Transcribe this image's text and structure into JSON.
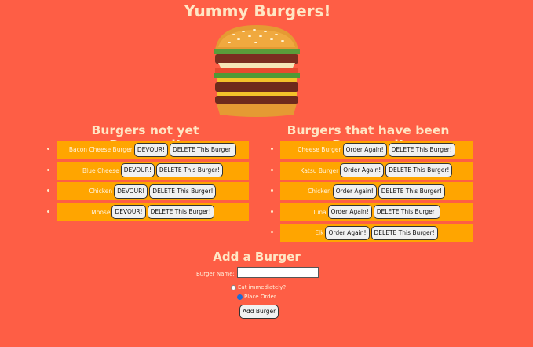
{
  "title": "Yummy Burgers!",
  "columns": {
    "not_devoured": {
      "heading": "Burgers not yet Devoured!",
      "items": [
        {
          "name": "Bacon Cheese Burger",
          "action": "DEVOUR!",
          "delete": "DELETE This Burger!"
        },
        {
          "name": "Blue Cheese",
          "action": "DEVOUR!",
          "delete": "DELETE This Burger!"
        },
        {
          "name": "Chicken",
          "action": "DEVOUR!",
          "delete": "DELETE This Burger!"
        },
        {
          "name": "Moose",
          "action": "DEVOUR!",
          "delete": "DELETE This Burger!"
        }
      ]
    },
    "devoured": {
      "heading": "Burgers that have been Devoured!",
      "items": [
        {
          "name": "Cheese Burger",
          "action": "Order Again!",
          "delete": "DELETE This Burger!"
        },
        {
          "name": "Katsu Burger",
          "action": "Order Again!",
          "delete": "DELETE This Burger!"
        },
        {
          "name": "Chicken",
          "action": "Order Again!",
          "delete": "DELETE This Burger!"
        },
        {
          "name": "Tuna",
          "action": "Order Again!",
          "delete": "DELETE This Burger!"
        },
        {
          "name": "Elk",
          "action": "Order Again!",
          "delete": "DELETE This Burger!"
        }
      ]
    }
  },
  "form": {
    "heading": "Add a Burger",
    "name_label": "Burger Name:",
    "name_value": "",
    "option_eat": "Eat immediately?",
    "option_order": "Place Order",
    "selected_option": "Place Order",
    "submit_label": "Add Burger"
  },
  "colors": {
    "background": "#fe5e45",
    "row_background": "#ffa500",
    "heading_text": "#ffe6c4"
  }
}
